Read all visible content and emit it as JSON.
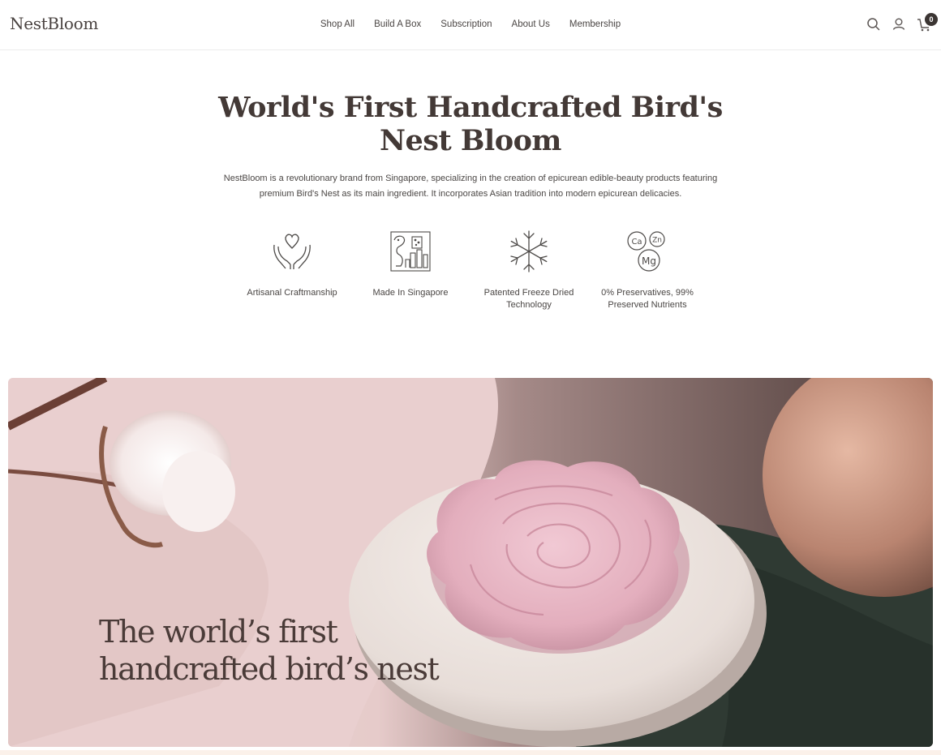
{
  "brand": {
    "logo": "NestBloom"
  },
  "nav": {
    "items": [
      "Shop All",
      "Build A Box",
      "Subscription",
      "About Us",
      "Membership"
    ]
  },
  "header_icons": {
    "search": "search-icon",
    "account": "user-icon",
    "cart": "cart-icon",
    "cart_count": "0"
  },
  "hero": {
    "title": "World's First Handcrafted Bird's Nest Bloom",
    "description": "NestBloom is a revolutionary brand from Singapore, specializing in the creation of epicurean edible-beauty products featuring premium Bird's Nest as its main ingredient. It incorporates Asian tradition into modern epicurean delicacies."
  },
  "features": [
    {
      "icon": "heart-hands-icon",
      "label": "Artisanal Craftmanship"
    },
    {
      "icon": "singapore-merlion-icon",
      "label": "Made In Singapore"
    },
    {
      "icon": "snowflake-icon",
      "label": "Patented Freeze Dried Technology"
    },
    {
      "icon": "minerals-icon",
      "label": "0% Preservatives, 99% Preserved Nutrients",
      "chips": [
        "Ca",
        "Zn",
        "Mg"
      ]
    }
  ],
  "banner": {
    "line1": "The world’s first",
    "line2": "handcrafted bird’s nest"
  },
  "colors": {
    "text": "#433936",
    "accent_dark": "#3b3533",
    "banner_pink": "#e9cfcf"
  }
}
